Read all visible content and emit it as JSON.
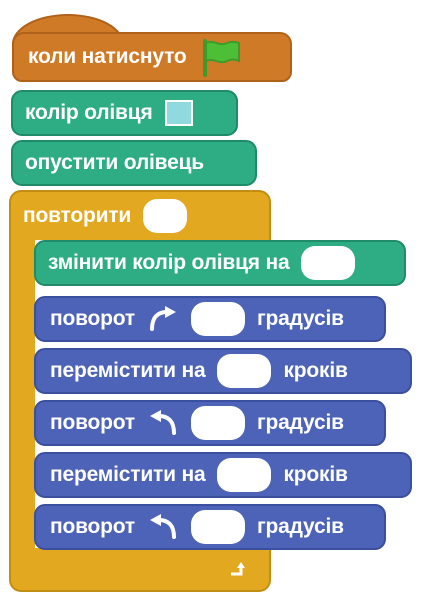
{
  "script": {
    "hat_label": "коли натиснуто",
    "pen_color_label": "колір олівця",
    "pen_color_value": "#90d9df",
    "pen_down_label": "опустити олівець",
    "repeat_label": "повторити",
    "change_pen_label": "змінити колір олівця на",
    "turn_label": "поворот",
    "degrees_label": "градусів",
    "move_label": "перемістити на",
    "steps_label": "кроків"
  },
  "colors": {
    "events": "#cf7a26",
    "pen": "#2ead85",
    "control": "#e2a81f",
    "motion": "#4d63b8",
    "flag": "#4cbf37"
  },
  "icons": {
    "flag": "green-flag-icon",
    "turn_right": "turn-right-icon",
    "turn_left": "turn-left-icon",
    "loop": "loop-arrow-icon"
  }
}
